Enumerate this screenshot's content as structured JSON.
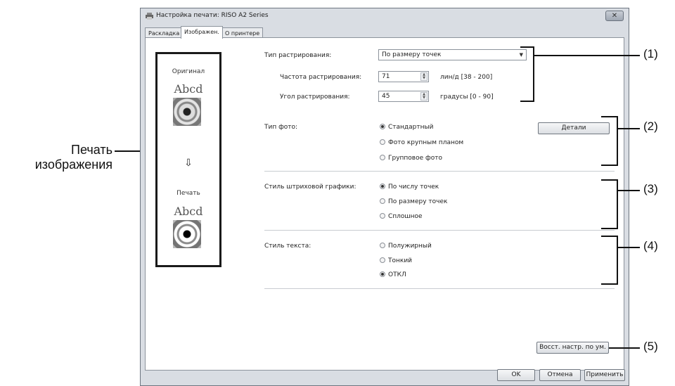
{
  "window": {
    "title": "Настройка печати: RISO A2 Series",
    "close_label": "✕"
  },
  "tabs": [
    {
      "label": "Раскладка"
    },
    {
      "label": "Изображен."
    },
    {
      "label": "О принтере"
    }
  ],
  "preview": {
    "original_label": "Оригинал",
    "original_text": "Abcd",
    "arrow": "⇩",
    "print_label": "Печать",
    "print_text": "Abcd"
  },
  "side_label": {
    "line1": "Печать",
    "line2": "изображения"
  },
  "screening": {
    "type_label": "Тип растрирования:",
    "type_value": "По размеру точек",
    "freq_label": "Частота растрирования:",
    "freq_value": "71",
    "freq_unit": "лин/д [38 - 200]",
    "angle_label": "Угол растрирования:",
    "angle_value": "45",
    "angle_unit": "градусы [0 - 90]"
  },
  "photo": {
    "label": "Тип фото:",
    "options": [
      {
        "label": "Стандартный",
        "selected": true
      },
      {
        "label": "Фото крупным планом",
        "selected": false
      },
      {
        "label": "Групповое фото",
        "selected": false
      }
    ],
    "details_button": "Детали"
  },
  "line_art": {
    "label": "Стиль штриховой графики:",
    "options": [
      {
        "label": "По числу точек",
        "selected": true
      },
      {
        "label": "По размеру точек",
        "selected": false
      },
      {
        "label": "Сплошное",
        "selected": false
      }
    ]
  },
  "text_style": {
    "label": "Стиль текста:",
    "options": [
      {
        "label": "Полужирный",
        "selected": false
      },
      {
        "label": "Тонкий",
        "selected": false
      },
      {
        "label": "ОТКЛ",
        "selected": true
      }
    ]
  },
  "restore_button": "Восст. настр. по ум.",
  "footer": {
    "ok": "OK",
    "cancel": "Отмена",
    "apply": "Применить"
  },
  "callouts": [
    "(1)",
    "(2)",
    "(3)",
    "(4)",
    "(5)"
  ],
  "icons": {
    "printer": "printer-icon",
    "dropdown": "chevron-down-icon",
    "spin": "spin-arrows-icon"
  }
}
